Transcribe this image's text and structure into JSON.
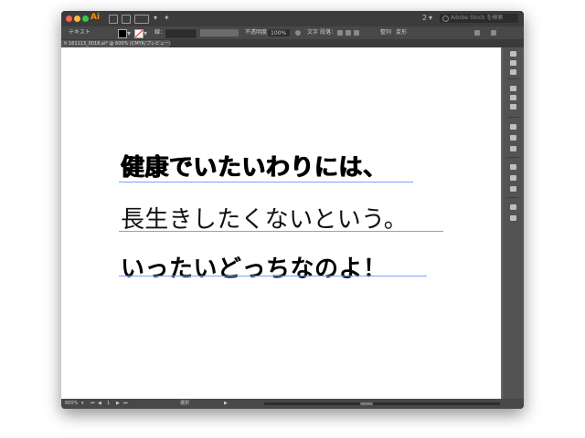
{
  "app": {
    "logo": "Ai"
  },
  "titlebar": {
    "workspace_label": "2",
    "search_placeholder": "Adobe Stock を検索"
  },
  "controlbar": {
    "selection_type": "テキスト",
    "stroke_label": "線：",
    "opacity_label": "不透明度：",
    "opacity_value": "100%",
    "char_label": "文字",
    "para_label": "段落：",
    "align_label": "整列",
    "transform_label": "変形"
  },
  "document_tab": {
    "title": "161113_0018.ai* @ 600% (CMYK/プレビュー)",
    "close_glyph": "×"
  },
  "artboard": {
    "lines": [
      "健康でいたいわりには、",
      "長生きしたくないという。",
      "いったいどっちなのよ！"
    ]
  },
  "statusbar": {
    "zoom": "600%",
    "page": "1",
    "mode": "選択"
  },
  "icons": {
    "search": "search-icon",
    "close": "close-icon"
  }
}
